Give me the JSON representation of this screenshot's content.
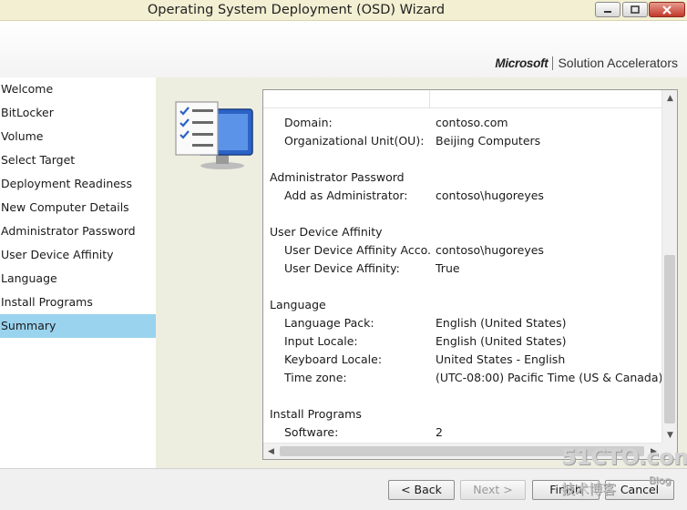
{
  "window": {
    "title": "Operating System Deployment (OSD) Wizard",
    "minimize_icon": "minimize-icon",
    "maximize_icon": "maximize-icon",
    "close_icon": "close-icon"
  },
  "header": {
    "ms_logo": "Microsoft",
    "brand_text": "Solution Accelerators"
  },
  "sidebar": {
    "items": [
      {
        "label": "Welcome"
      },
      {
        "label": "BitLocker"
      },
      {
        "label": "Volume"
      },
      {
        "label": "Select Target"
      },
      {
        "label": "Deployment Readiness"
      },
      {
        "label": "New Computer Details"
      },
      {
        "label": "Administrator Password"
      },
      {
        "label": "User Device Affinity"
      },
      {
        "label": "Language"
      },
      {
        "label": "Install Programs"
      },
      {
        "label": "Summary"
      }
    ],
    "active": "Summary"
  },
  "summary": {
    "rows": [
      {
        "type": "item",
        "key": "Domain:",
        "value": "contoso.com"
      },
      {
        "type": "item",
        "key": "Organizational Unit(OU):",
        "value": "Beijing Computers"
      },
      {
        "type": "blank"
      },
      {
        "type": "group",
        "key": "Administrator Password",
        "value": ""
      },
      {
        "type": "item",
        "key": "Add as Administrator:",
        "value": "contoso\\hugoreyes"
      },
      {
        "type": "blank"
      },
      {
        "type": "group",
        "key": "User Device Affinity",
        "value": ""
      },
      {
        "type": "item",
        "key": "User Device Affinity Acco...",
        "value": "contoso\\hugoreyes"
      },
      {
        "type": "item",
        "key": "User Device Affinity:",
        "value": "True"
      },
      {
        "type": "blank"
      },
      {
        "type": "group",
        "key": "Language",
        "value": ""
      },
      {
        "type": "item",
        "key": "Language Pack:",
        "value": "English (United States)"
      },
      {
        "type": "item",
        "key": "Input Locale:",
        "value": "English (United States)"
      },
      {
        "type": "item",
        "key": "Keyboard Locale:",
        "value": "United States - English"
      },
      {
        "type": "item",
        "key": "Time zone:",
        "value": "(UTC-08:00) Pacific Time (US & Canada)"
      },
      {
        "type": "blank"
      },
      {
        "type": "group",
        "key": "Install Programs",
        "value": ""
      },
      {
        "type": "item",
        "key": "Software:",
        "value": "2"
      }
    ]
  },
  "footer": {
    "back_label": "< Back",
    "next_label": "Next >",
    "finish_label": "Finish",
    "cancel_label": "Cancel"
  },
  "watermark": {
    "big": "51CTO.com",
    "small": "技术博客",
    "blog": "Blog"
  },
  "colors": {
    "titlebar": "#f2efd2",
    "active_nav": "#9ad3ee",
    "content_bg": "#eeeee0"
  }
}
